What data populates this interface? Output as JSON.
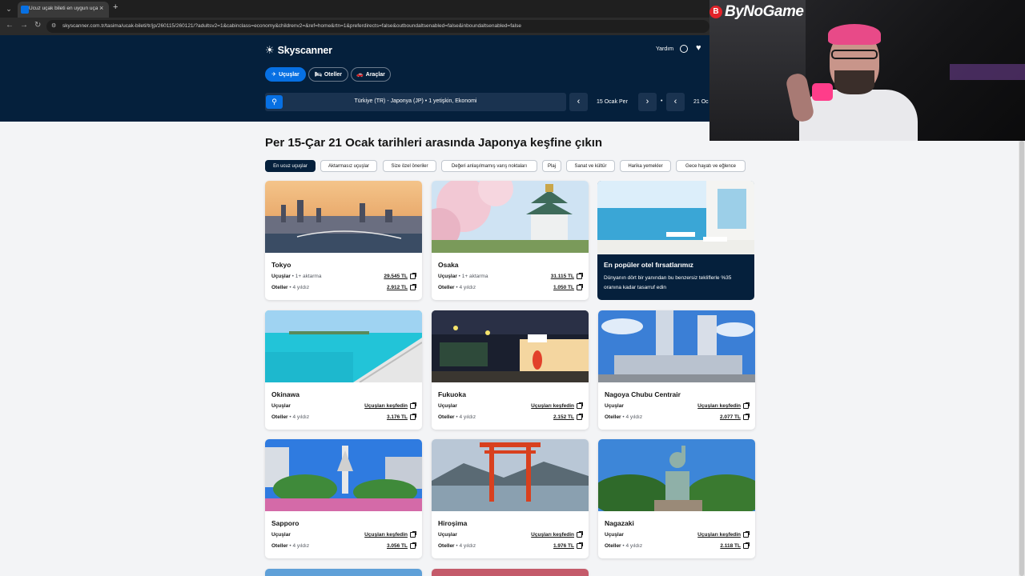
{
  "browser": {
    "tab_title": "Ucuz uçak bileti en uygun uçak",
    "new_tab": "+",
    "close": "×",
    "url": "skyscanner.com.tr/tasima/ucak-bileti/tr/jp/260115/260121/?adultsv2=1&cabinclass=economy&childrenv2=&ref=home&rtn=1&preferdirects=false&outboundaltsenabled=false&inboundaltsenabled=false"
  },
  "header": {
    "logo": "Skyscanner",
    "help": "Yardım",
    "nav": [
      {
        "label": "Uçuşlar",
        "icon": "✈"
      },
      {
        "label": "Oteller",
        "icon": "🛏"
      },
      {
        "label": "Araçlar",
        "icon": "🚗"
      }
    ],
    "search_text": "Türkiye (TR) - Japonya (JP)  •  1 yetişkin, Ekonomi",
    "depart_date": "15 Ocak Per",
    "return_date": "21 Oc",
    "dot": "•"
  },
  "webcam": {
    "brand": "ByNoGame",
    "brand_mark": "B"
  },
  "main": {
    "title": "Per 15-Çar 21 Ocak tarihleri arasında Japonya keşfine çıkın",
    "chips": [
      "En ucuz uçuşlar",
      "Aktarmasız uçuşlar",
      "Size özel öneriler",
      "Değeri anlaşılmamış varış noktaları",
      "Plaj",
      "Sanat ve kültür",
      "Harika yemekler",
      "Gece hayatı ve eğlence"
    ],
    "flights_label": "Uçuşlar",
    "hotels_label": "Oteller",
    "stars": "4 yıldız",
    "promo": {
      "title": "En popüler otel fırsatlarımız",
      "text": "Dünyanın dört bir yanından bu benzersiz tekliflerle %35 oranına kadar tasarruf edin"
    },
    "cards": [
      {
        "name": "Tokyo",
        "flight_sub": "1+ aktarma",
        "flight_price": "29.545 TL",
        "hotel_price": "2.912 TL"
      },
      {
        "name": "Osaka",
        "flight_sub": "1+ aktarma",
        "flight_price": "31.115 TL",
        "hotel_price": "1.050 TL"
      },
      {
        "name": "Okinawa",
        "flight_sub": "",
        "flight_price": "Uçuşları keşfedin",
        "hotel_price": "3.176 TL"
      },
      {
        "name": "Fukuoka",
        "flight_sub": "",
        "flight_price": "Uçuşları keşfedin",
        "hotel_price": "2.152 TL"
      },
      {
        "name": "Nagoya Chubu Centrair",
        "flight_sub": "",
        "flight_price": "Uçuşları keşfedin",
        "hotel_price": "2.077 TL"
      },
      {
        "name": "Sapporo",
        "flight_sub": "",
        "flight_price": "Uçuşları keşfedin",
        "hotel_price": "3.056 TL"
      },
      {
        "name": "Hiroşima",
        "flight_sub": "",
        "flight_price": "Uçuşları keşfedin",
        "hotel_price": "1.976 TL"
      },
      {
        "name": "Nagazaki",
        "flight_sub": "",
        "flight_price": "Uçuşları keşfedin",
        "hotel_price": "2.118 TL"
      }
    ]
  }
}
